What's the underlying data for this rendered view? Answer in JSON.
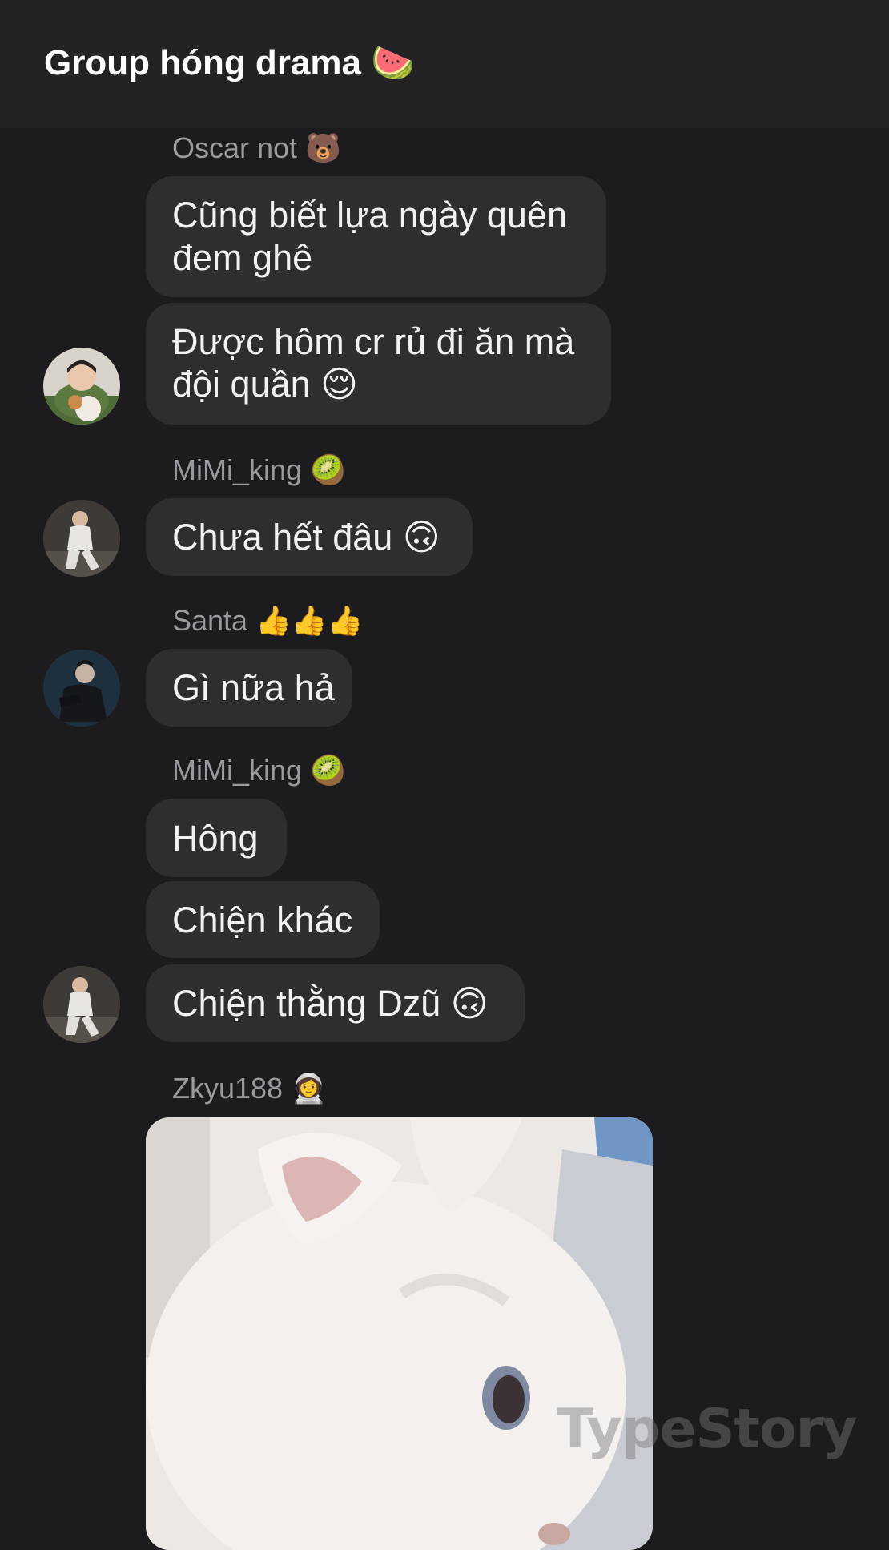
{
  "header": {
    "title": "Group hóng drama 🍉"
  },
  "messages": [
    {
      "sender": "Oscar not 🐻",
      "lines": [
        "Cũng biết lựa ngày quên",
        "đem ghê"
      ]
    },
    {
      "lines": [
        "Được hôm cr rủ đi ăn mà",
        "đội quần 😌"
      ]
    },
    {
      "sender": "MiMi_king 🥝",
      "text": "Chưa hết đâu 🙃"
    },
    {
      "sender": "Santa 👍👍👍",
      "text": "Gì nữa hả"
    },
    {
      "sender": "MiMi_king 🥝",
      "text": "Hông"
    },
    {
      "text": "Chiện khác"
    },
    {
      "text": "Chiện thằng Dzũ 🙃"
    },
    {
      "sender": "Zkyu188 👩‍🚀"
    }
  ],
  "watermark": "TypeStory"
}
